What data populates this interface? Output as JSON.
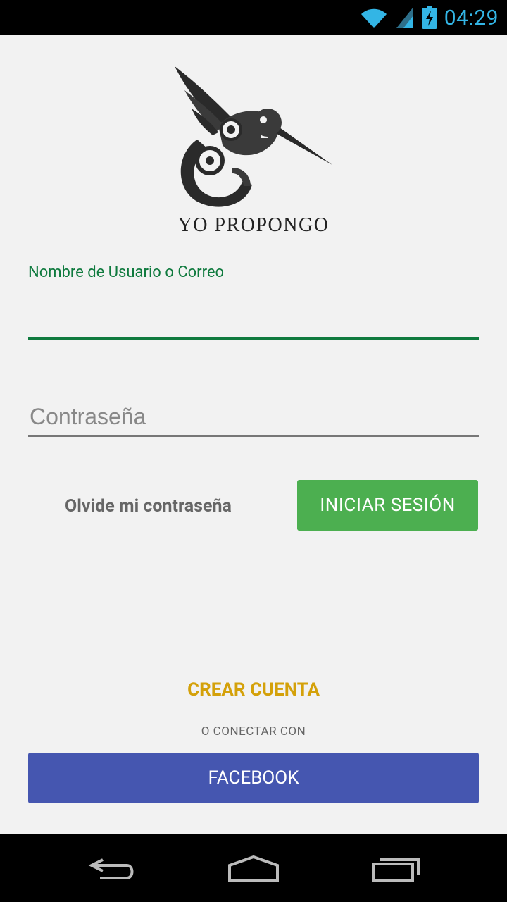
{
  "status_bar": {
    "time": "04:29",
    "icons": [
      "wifi-icon",
      "signal-icon",
      "battery-charging-icon"
    ],
    "accent_color": "#33b5e5"
  },
  "logo": {
    "icon": "hummingbird-logo-icon",
    "brand_text": "YO PROPONGO"
  },
  "login_form": {
    "username_label": "Nombre de Usuario o Correo",
    "username_value": "",
    "password_placeholder": "Contraseña",
    "password_value": "",
    "forgot_password_label": "Olvide mi contraseña",
    "login_button_label": "INICIAR SESIÓN",
    "accent_color": "#0f7a3e",
    "login_button_color": "#4caf50"
  },
  "signup": {
    "create_account_label": "CREAR CUENTA",
    "connect_with_label": "O CONECTAR CON",
    "facebook_button_label": "FACEBOOK",
    "create_account_color": "#d4a10a",
    "facebook_button_color": "#4556b0"
  },
  "navigation_bar": {
    "icons": [
      "back-icon",
      "home-icon",
      "recent-apps-icon"
    ]
  }
}
